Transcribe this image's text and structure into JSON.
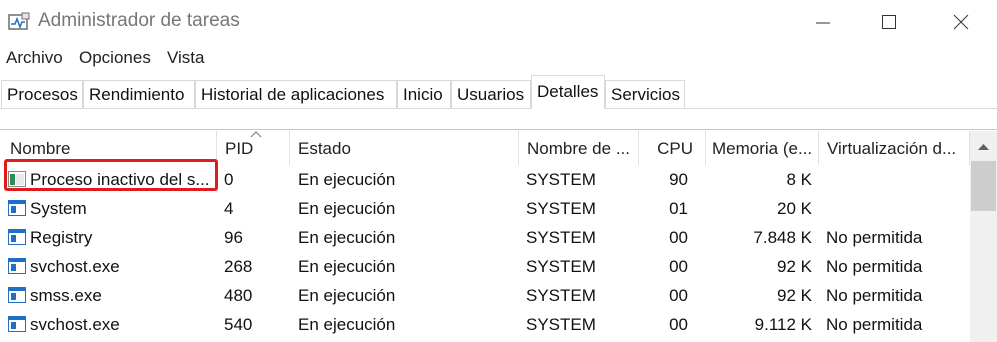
{
  "window": {
    "title": "Administrador de tareas",
    "icon": "task-manager-icon",
    "controls": [
      "minimize-icon",
      "maximize-icon",
      "close-icon"
    ]
  },
  "menu": {
    "items": [
      "Archivo",
      "Opciones",
      "Vista"
    ]
  },
  "tabs": {
    "items": [
      "Procesos",
      "Rendimiento",
      "Historial de aplicaciones",
      "Inicio",
      "Usuarios",
      "Detalles",
      "Servicios"
    ],
    "active": "Detalles"
  },
  "table": {
    "columns": [
      "Nombre",
      "PID",
      "Estado",
      "Nombre de ...",
      "CPU",
      "Memoria (e...",
      "Virtualización d..."
    ],
    "sorted_column": "PID",
    "rows": [
      {
        "name": "Proceso inactivo del s...",
        "pid": "0",
        "status": "En ejecución",
        "user": "SYSTEM",
        "cpu": "90",
        "memory": "8 K",
        "virtualization": ""
      },
      {
        "name": "System",
        "pid": "4",
        "status": "En ejecución",
        "user": "SYSTEM",
        "cpu": "01",
        "memory": "20 K",
        "virtualization": ""
      },
      {
        "name": "Registry",
        "pid": "96",
        "status": "En ejecución",
        "user": "SYSTEM",
        "cpu": "00",
        "memory": "7.848 K",
        "virtualization": "No permitida"
      },
      {
        "name": "svchost.exe",
        "pid": "268",
        "status": "En ejecución",
        "user": "SYSTEM",
        "cpu": "00",
        "memory": "92 K",
        "virtualization": "No permitida"
      },
      {
        "name": "smss.exe",
        "pid": "480",
        "status": "En ejecución",
        "user": "SYSTEM",
        "cpu": "00",
        "memory": "92 K",
        "virtualization": "No permitida"
      },
      {
        "name": "svchost.exe",
        "pid": "540",
        "status": "En ejecución",
        "user": "SYSTEM",
        "cpu": "00",
        "memory": "9.112 K",
        "virtualization": "No permitida"
      }
    ]
  },
  "colors": {
    "highlight": "#e01b1b",
    "icon_blue": "#1f6fc5",
    "title_text": "#777777"
  }
}
